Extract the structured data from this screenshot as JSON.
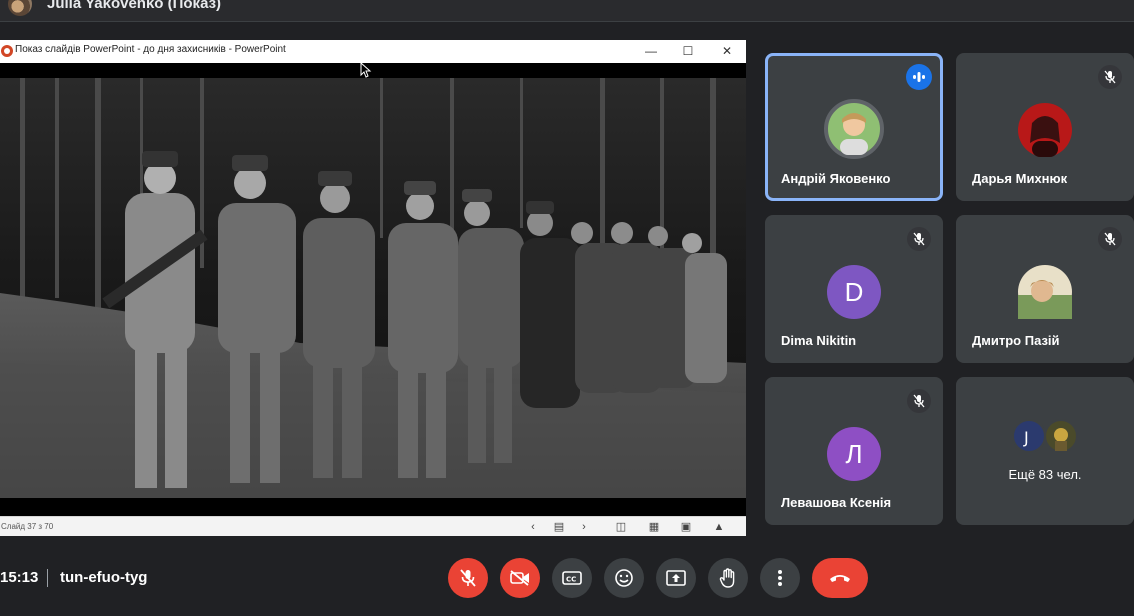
{
  "presenter": {
    "name": "Julia Yakovenko (Показ)"
  },
  "presentation": {
    "window_title": "Показ слайдів PowerPoint  -  до дня захисників  -  PowerPoint",
    "slide_counter": "Слайд 37 з 70",
    "window_controls": {
      "minimize": "—",
      "maximize": "☐",
      "close": "✕"
    }
  },
  "participants": [
    {
      "name": "Андрій Яковенко",
      "speaking": true,
      "muted": false,
      "avatar": "photo"
    },
    {
      "name": "Дарья Михнюк",
      "speaking": false,
      "muted": true,
      "avatar": "photo"
    },
    {
      "name": "Dima Nikitin",
      "speaking": false,
      "muted": true,
      "avatar_letter": "D",
      "avatar_color": "#7e57c2"
    },
    {
      "name": "Дмитро Пазій",
      "speaking": false,
      "muted": true,
      "avatar": "photo"
    },
    {
      "name": "Левашова Ксенія",
      "speaking": false,
      "muted": true,
      "avatar_letter": "Л",
      "avatar_color": "#8e4fc4"
    }
  ],
  "more": {
    "label": "Ещё 83 чел."
  },
  "meeting": {
    "time": "15:13",
    "code": "tun-efuo-tyg"
  },
  "colors": {
    "background": "#202124",
    "tile": "#3c4043",
    "accent": "#8ab4f8",
    "danger": "#ea4335",
    "speaking": "#1a73e8"
  },
  "controls": [
    {
      "icon": "mic-off-icon",
      "state": "off"
    },
    {
      "icon": "camera-off-icon",
      "state": "off"
    },
    {
      "icon": "captions-icon"
    },
    {
      "icon": "emoji-icon"
    },
    {
      "icon": "present-screen-icon"
    },
    {
      "icon": "raise-hand-icon"
    },
    {
      "icon": "more-options-icon"
    },
    {
      "icon": "hang-up-icon"
    }
  ]
}
